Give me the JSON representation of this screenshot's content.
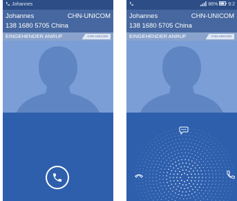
{
  "left_screen": {
    "status": {
      "call_icon": "phone-icon",
      "caller": "Johannes"
    },
    "caller": {
      "name": "Johannes",
      "carrier": "CHN-UNICOM",
      "number": "138 1680 5705 China"
    },
    "incoming": {
      "label": "EINGEHENDER ANRUF",
      "badge": "CHN-UNICOM"
    },
    "answer_icon": "phone-handset-icon"
  },
  "right_screen": {
    "status": {
      "call_icon": "phone-icon",
      "signal_icon": "signal-icon",
      "battery_percent": "86%",
      "battery_icon": "battery-icon",
      "time": "9:2"
    },
    "caller": {
      "name": "Johannes",
      "carrier": "CHN-UNICOM",
      "number": "138 1680 5705 China"
    },
    "incoming": {
      "label": "EINGEHENDER ANRUF",
      "badge": "CHN-UNICOM"
    },
    "glow_icons": {
      "top": "message-bubble-icon",
      "left": "decline-phone-icon",
      "right": "answer-phone-icon"
    }
  },
  "colors": {
    "statusbar": "#2c4d85",
    "caller_bar": "#46679f",
    "incoming_bar": "#8aa3cc",
    "photo_bg": "#7b9ed6",
    "silhouette": "#5f86c2",
    "lower_bg": "#2e5fad"
  }
}
